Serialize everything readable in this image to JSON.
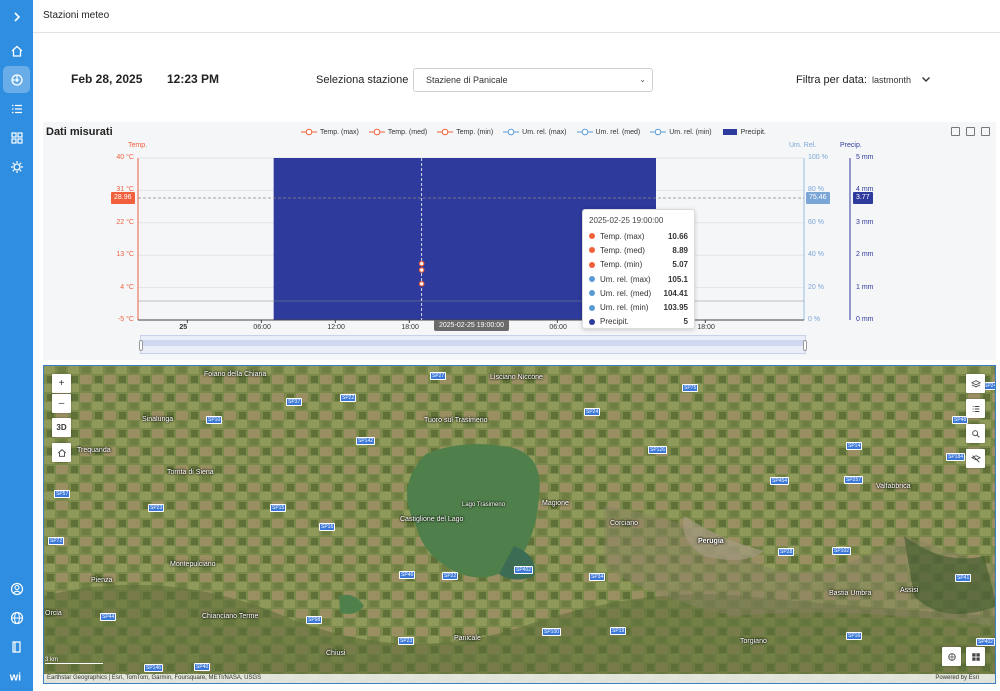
{
  "header": {
    "title": "Stazioni meteo"
  },
  "datetime": {
    "date": "Feb 28, 2025",
    "time": "12:23 PM"
  },
  "station": {
    "label": "Seleziona stazione",
    "selected": "Staziene di Panicale"
  },
  "filter": {
    "label": "Filtra per data:",
    "value": "lastmonth"
  },
  "chart": {
    "title": "Dati misurati",
    "legend": [
      "Temp. (max)",
      "Temp. (med)",
      "Temp. (min)",
      "Um. rel. (max)",
      "Um. rel. (med)",
      "Um. rel. (min)",
      "Precipit."
    ],
    "legend_colors": [
      "#f0603c",
      "#f0603c",
      "#f0603c",
      "#5b9bd5",
      "#5b9bd5",
      "#5b9bd5",
      "#2e3a9c"
    ],
    "y_left_title": "Temp.",
    "y_right1_title": "Um. Rel.",
    "y_right2_title": "Precip.",
    "y_left_ticks": [
      "40 °C",
      "31 °C",
      "22 °C",
      "13 °C",
      "4 °C",
      "-5 °C"
    ],
    "y_right1_ticks": [
      "100 %",
      "80 %",
      "60 %",
      "40 %",
      "20 %",
      "0 %"
    ],
    "y_right2_ticks": [
      "5 mm",
      "4 mm",
      "3 mm",
      "2 mm",
      "1 mm",
      "0 mm"
    ],
    "x_ticks": [
      "25",
      "06:00",
      "12:00",
      "18:00",
      "26",
      "06:00",
      "12:00",
      "18:00"
    ],
    "left_axis_pointer": "28.96",
    "right1_axis_pointer": "75.46",
    "right2_axis_pointer": "3.77",
    "cursor_time": "2025-02-25 19:00:00",
    "colors": {
      "temp": "#f0603c",
      "humidity": "#5b9bd5",
      "precip": "#2e3a9c"
    }
  },
  "tooltip": {
    "time": "2025-02-25 19:00:00",
    "rows": [
      {
        "label": "Temp. (max)",
        "value": "10.66",
        "color": "#f0603c"
      },
      {
        "label": "Temp. (med)",
        "value": "8.89",
        "color": "#f0603c"
      },
      {
        "label": "Temp. (min)",
        "value": "5.07",
        "color": "#f0603c"
      },
      {
        "label": "Um. rel. (max)",
        "value": "105.1",
        "color": "#5b9bd5"
      },
      {
        "label": "Um. rel. (med)",
        "value": "104.41",
        "color": "#5b9bd5"
      },
      {
        "label": "Um. rel. (min)",
        "value": "103.95",
        "color": "#5b9bd5"
      },
      {
        "label": "Precipit.",
        "value": "5",
        "color": "#2e3a9c"
      }
    ]
  },
  "chart_data": {
    "type": "bar",
    "title": "Dati misurati",
    "x_range": [
      "2025-02-24 20:00",
      "2025-02-27 02:00"
    ],
    "ylim_temp": [
      -5,
      40
    ],
    "ylim_humidity": [
      0,
      100
    ],
    "ylim_precip": [
      0,
      5
    ],
    "series": [
      {
        "name": "Precipit.",
        "axis": "precip",
        "kind": "bar",
        "x_start": "2025-02-25 07:00",
        "x_end": "2025-02-26 14:00",
        "value": 5
      },
      {
        "name": "Temp. (max)",
        "axis": "temp",
        "kind": "line",
        "x": [
          "2025-02-25 19:00"
        ],
        "y": [
          10.66
        ]
      },
      {
        "name": "Temp. (med)",
        "axis": "temp",
        "kind": "line",
        "x": [
          "2025-02-25 19:00"
        ],
        "y": [
          8.89
        ]
      },
      {
        "name": "Temp. (min)",
        "axis": "temp",
        "kind": "line",
        "x": [
          "2025-02-25 19:00"
        ],
        "y": [
          5.07
        ]
      },
      {
        "name": "Um. rel. (max)",
        "axis": "humidity",
        "kind": "line",
        "x": [
          "2025-02-25 19:00"
        ],
        "y": [
          105.1
        ]
      },
      {
        "name": "Um. rel. (med)",
        "axis": "humidity",
        "kind": "line",
        "x": [
          "2025-02-25 19:00"
        ],
        "y": [
          104.41
        ]
      },
      {
        "name": "Um. rel. (min)",
        "axis": "humidity",
        "kind": "line",
        "x": [
          "2025-02-25 19:00"
        ],
        "y": [
          103.95
        ]
      }
    ],
    "grid": true,
    "legend_position": "top-center"
  },
  "map": {
    "places": [
      "Foiano della Chiana",
      "Lisciano Niccone",
      "Sinalunga",
      "Tuoro sul Trasimeno",
      "Trequanda",
      "Torrita di Siena",
      "Lago Trasimeno",
      "Magione",
      "Castiglione del Lago",
      "Corciano",
      "Perugia",
      "Valfabbrica",
      "Montepulciano",
      "Pienza",
      "Bastia Umbra",
      "Assisi",
      "Chianciano Terme",
      "Panicale",
      "Chiusi",
      "Torgiano",
      "Orcia",
      "Pieve"
    ],
    "roads": [
      "SP27",
      "SP37",
      "SP22",
      "SP10",
      "SP75",
      "SP24",
      "SP142",
      "SP126",
      "SP57",
      "SP14",
      "SP23",
      "SP15",
      "SP16",
      "SP454",
      "SP72",
      "SP184",
      "SP257",
      "SP28",
      "SP102",
      "SP22",
      "SP46",
      "SP402",
      "SP98",
      "SP34",
      "SP44",
      "SP19",
      "SP23",
      "SP100",
      "SP41",
      "SP16",
      "SP146",
      "SP402",
      "SP40",
      "SP246",
      "SP48"
    ],
    "attribution": "Earthstar Geographics | Esri, TomTom, Garmin, Foursquare, METI/NASA, USGS",
    "powered": "Powered by Esri",
    "scale": "3 km",
    "btn_3d": "3D",
    "zoom_in": "+",
    "zoom_out": "–"
  },
  "icons": {
    "sidebar": [
      "chevron-right-icon",
      "home-icon",
      "dashboard-icon",
      "list-icon",
      "grid-icon",
      "settings-icon",
      "user-circle-icon",
      "globe-icon",
      "book-icon",
      "logo-icon"
    ]
  },
  "logo_text": "wi"
}
